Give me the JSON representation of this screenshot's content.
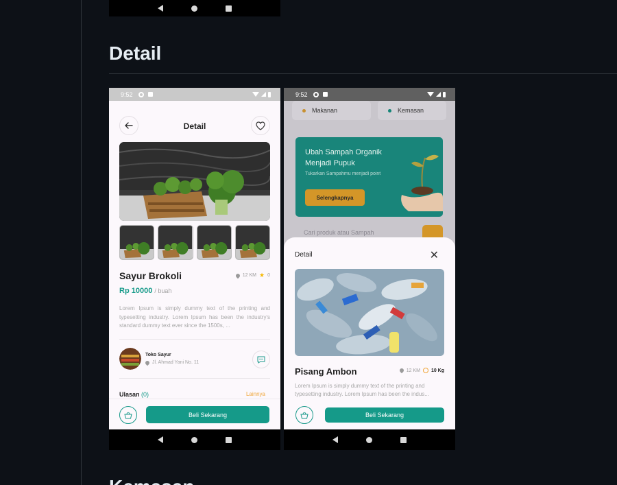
{
  "section": {
    "title": "Detail",
    "next_title": "Kemasan"
  },
  "status": {
    "time": "9:52"
  },
  "phone1": {
    "header_title": "Detail",
    "product_name": "Sayur Brokoli",
    "distance": "12 KM",
    "rating": "0",
    "price": "Rp 10000",
    "unit": "/ buah",
    "description": "Lorem Ipsum is simply dummy text of the printing and typesetting industry. Lorem Ipsum has been the industry's standard dummy text ever since the 1500s, ...",
    "seller_name": "Toko Sayur",
    "seller_address": "Jl. Ahmad Yani No. 11",
    "reviews_label": "Ulasan",
    "reviews_count": "(0)",
    "more_label": "Lainnya",
    "buy_label": "Beli Sekarang"
  },
  "phone2": {
    "chips": [
      {
        "label": "Makanan",
        "color": "#f0a638"
      },
      {
        "label": "Kemasan",
        "color": "#159a89"
      }
    ],
    "banner_title": "Ubah Sampah Organik Menjadi Pupuk",
    "banner_subtitle": "Tukarkan Sampahmu menjadi point",
    "banner_button": "Selengkapnya",
    "search_placeholder": "Cari produk atau Sampah",
    "sheet_title": "Detail",
    "product_name": "Pisang Ambon",
    "distance": "12 KM",
    "weight": "10 Kg",
    "description_line1": "Lorem Ipsum is simply dummy text of the printing and",
    "description_line2": "typesetting industry. Lorem Ipsum has been the indus...",
    "buy_label": "Beli Sekarang"
  },
  "colors": {
    "primary": "#159a89",
    "accent": "#f0a638",
    "page_bg": "#0d1117"
  }
}
